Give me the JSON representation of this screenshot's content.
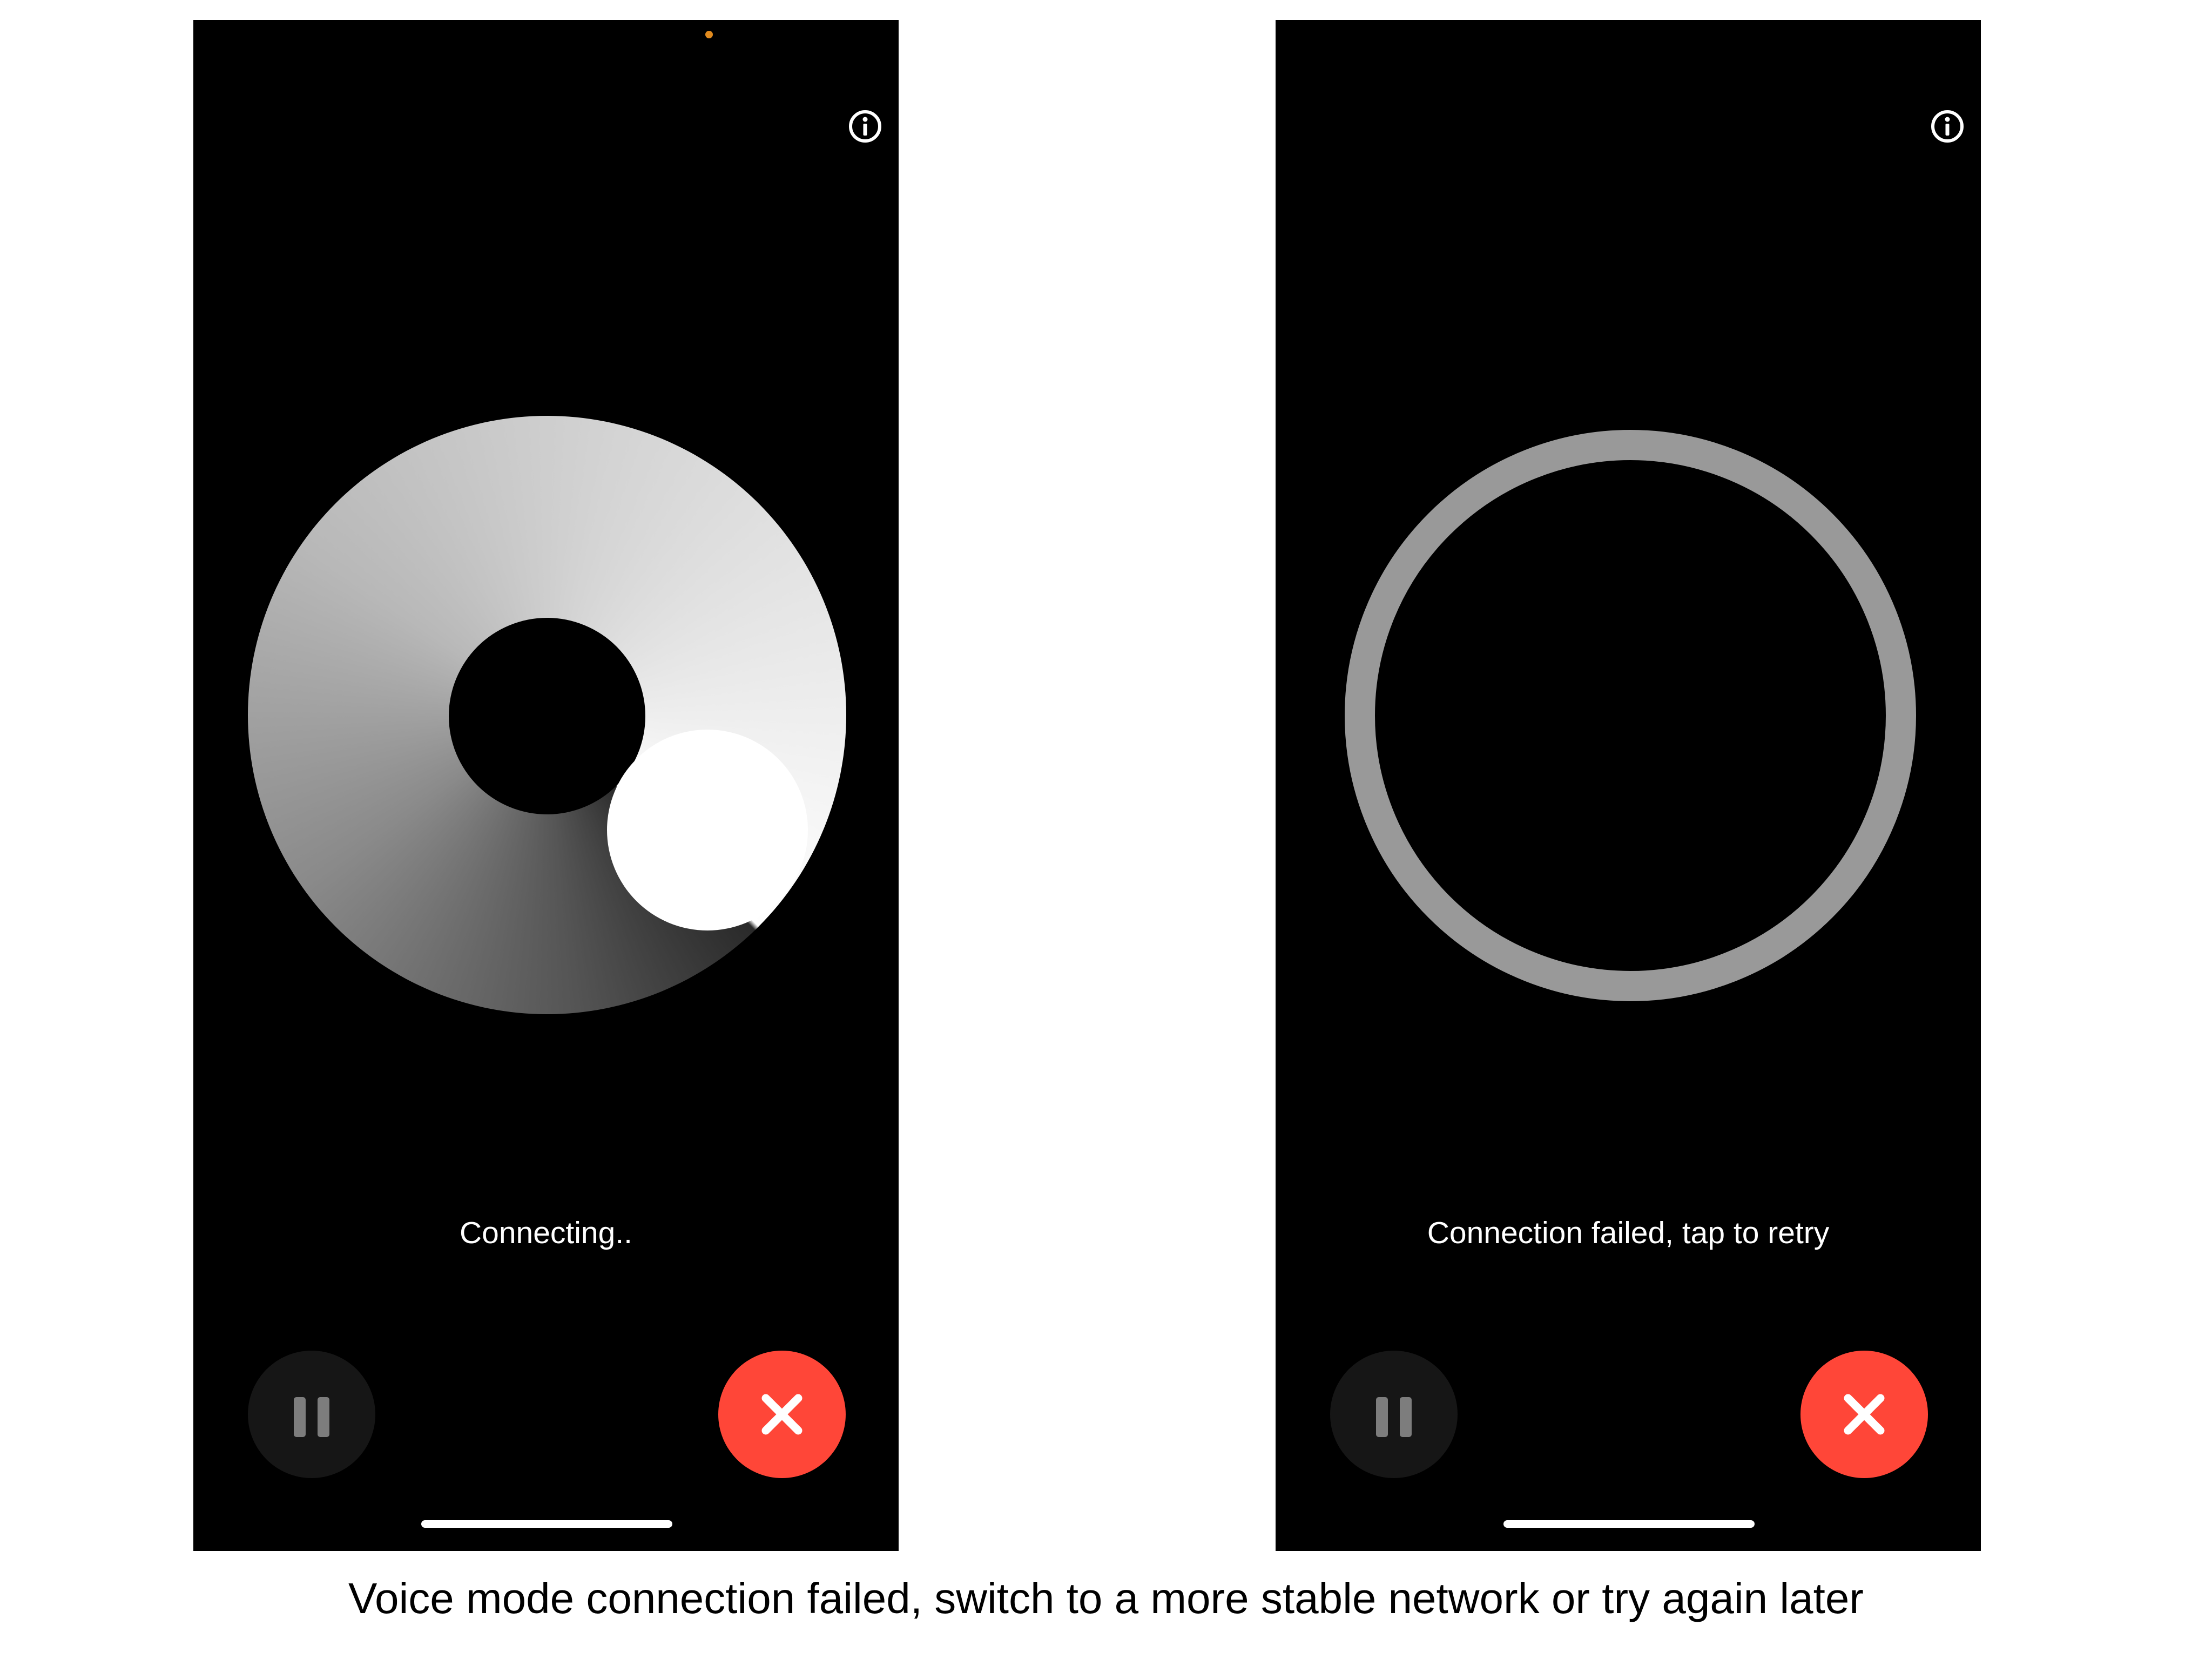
{
  "colors": {
    "phone_background": "#000000",
    "accent_red": "#FF4638",
    "status_dot": "#E08A1E",
    "ring_gray": "#999999",
    "pause_button_bg": "#161616",
    "pause_icon": "#7D7D7D"
  },
  "screens": [
    {
      "state": "connecting",
      "status_text": "Connecting..",
      "icons": {
        "info": "info-icon",
        "pause": "pause-icon",
        "close": "close-icon"
      }
    },
    {
      "state": "failed",
      "status_text": "Connection failed, tap to retry",
      "icons": {
        "info": "info-icon",
        "pause": "pause-icon",
        "close": "close-icon"
      }
    }
  ],
  "caption": "Voice mode connection failed, switch to a more stable network or try again later"
}
